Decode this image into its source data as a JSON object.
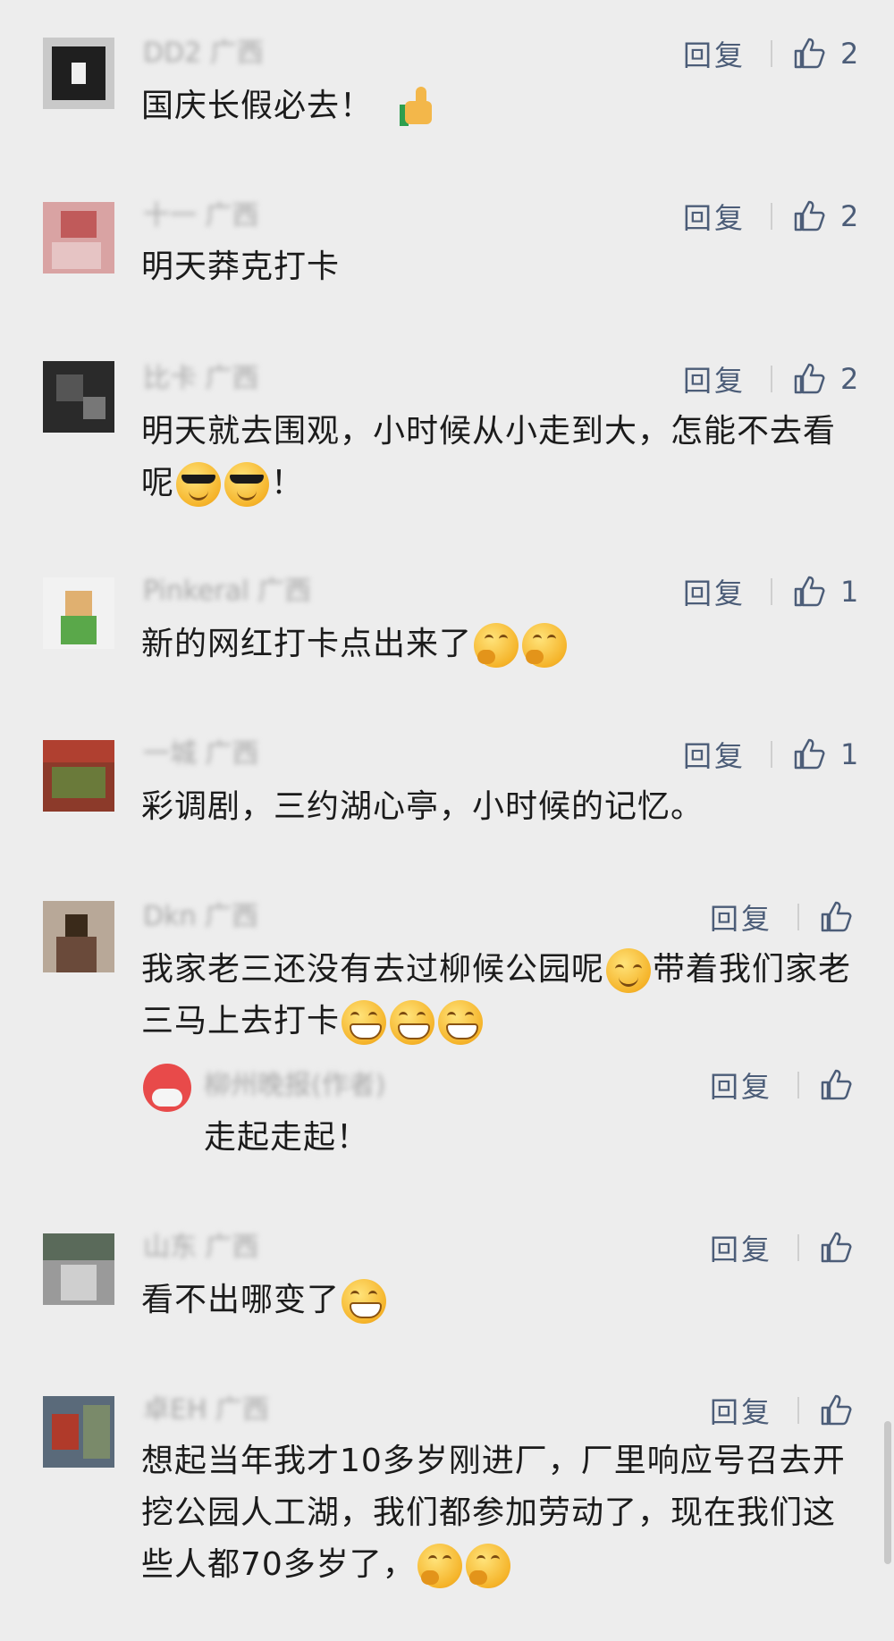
{
  "actions": {
    "reply_label": "回复"
  },
  "comments": [
    {
      "author": "DD2 广西",
      "text": "国庆长假必去！",
      "likes": "2"
    },
    {
      "author": "十一 广西",
      "text": "明天莽克打卡",
      "likes": "2"
    },
    {
      "author": "比卡 广西",
      "text": "明天就去围观，小时候从小走到大，怎能不去看呢",
      "text_end": "！",
      "likes": "2"
    },
    {
      "author": "Pinkeral 广西",
      "text": "新的网红打卡点出来了",
      "likes": "1"
    },
    {
      "author": "一城 广西",
      "text": "彩调剧，三约湖心亭，小时候的记忆。",
      "likes": "1"
    },
    {
      "author": "Dkn 广西",
      "text_a": "我家老三还没有去过柳候公园呢",
      "text_b": "带着我们家老三马上去打卡",
      "likes": ""
    },
    {
      "author": "山东 广西",
      "text": "看不出哪变了",
      "likes": ""
    },
    {
      "author": "卓EH 广西",
      "text": "想起当年我才10多岁刚进厂，厂里响应号召去开挖公园人工湖，我们都参加劳动了，现在我们这些人都70多岁了，",
      "likes": ""
    }
  ],
  "reply": {
    "author": "柳州晚报(作者)",
    "text": "走起走起！"
  },
  "colors": {
    "background": "#ededed",
    "action": "#4c5d78",
    "text": "#1b1b1b",
    "name": "#a8a8a8"
  },
  "icons": {
    "like": "thumbs-up-outline-icon"
  }
}
